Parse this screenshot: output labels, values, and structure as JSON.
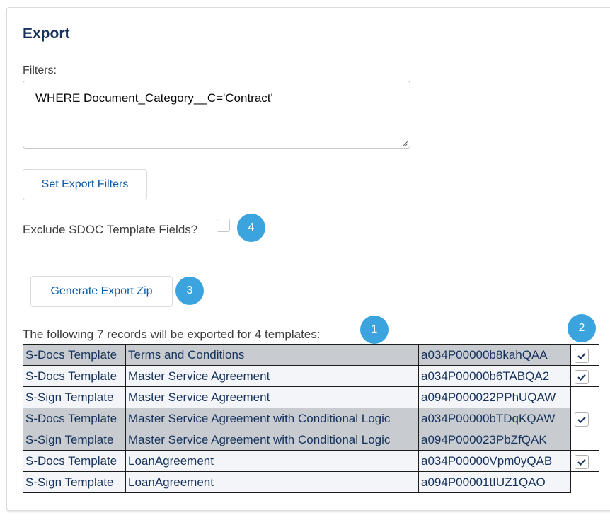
{
  "export": {
    "title": "Export",
    "filters_label": "Filters:",
    "filters_value": "WHERE Document_Category__C='Contract'",
    "set_filters_button": "Set Export Filters",
    "exclude_label": "Exclude SDOC Template Fields?",
    "exclude_checked": false,
    "generate_button": "Generate Export Zip",
    "summary": "The following 7 records will be exported for 4 templates:"
  },
  "badges": {
    "b1": "1",
    "b2": "2",
    "b3": "3",
    "b4": "4"
  },
  "records": [
    {
      "type": "S-Docs Template",
      "name": "Terms and Conditions",
      "id": "a034P00000b8kahQAA",
      "checked": true,
      "shade": "gray"
    },
    {
      "type": "S-Docs Template",
      "name": "Master Service Agreement",
      "id": "a034P00000b6TABQA2",
      "checked": true,
      "shade": "white"
    },
    {
      "type": "S-Sign Template",
      "name": "Master Service Agreement",
      "id": "a094P000022PPhUQAW",
      "checked": false,
      "shade": "white"
    },
    {
      "type": "S-Docs Template",
      "name": "Master Service Agreement with Conditional Logic",
      "id": "a034P00000bTDqKQAW",
      "checked": true,
      "shade": "gray"
    },
    {
      "type": "S-Sign Template",
      "name": "Master Service Agreement with Conditional Logic",
      "id": "a094P000023PbZfQAK",
      "checked": false,
      "shade": "gray"
    },
    {
      "type": "S-Docs Template",
      "name": "LoanAgreement",
      "id": "a034P00000Vpm0yQAB",
      "checked": true,
      "shade": "white"
    },
    {
      "type": "S-Sign Template",
      "name": "LoanAgreement",
      "id": "a094P00001tIUZ1QAO",
      "checked": false,
      "shade": "white"
    }
  ],
  "colors": {
    "accent": "#0b5cab",
    "badge": "#3ba3de",
    "row_gray": "#c8ccd0",
    "row_white": "#f3f5f8"
  }
}
